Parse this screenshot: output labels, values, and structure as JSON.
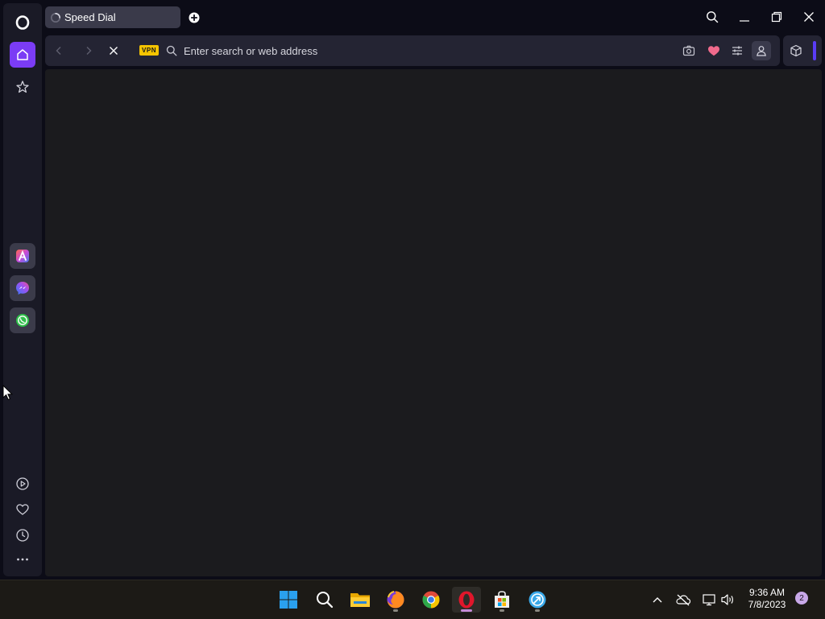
{
  "browser": {
    "tab": {
      "title": "Speed Dial",
      "loading": true
    },
    "address_bar": {
      "placeholder": "Enter search or web address",
      "value": "",
      "vpn_label": "VPN"
    }
  },
  "sidebar": {
    "top_items": [
      {
        "name": "home",
        "icon": "home-icon",
        "active": true
      },
      {
        "name": "bookmarks",
        "icon": "star-icon",
        "active": false
      }
    ],
    "apps": [
      {
        "name": "aria",
        "icon": "aria-icon"
      },
      {
        "name": "messenger",
        "icon": "messenger-icon"
      },
      {
        "name": "whatsapp",
        "icon": "whatsapp-icon"
      }
    ],
    "bottom_items": [
      {
        "name": "player",
        "icon": "play-circle-icon"
      },
      {
        "name": "my-flow",
        "icon": "heart-icon"
      },
      {
        "name": "history",
        "icon": "clock-icon"
      },
      {
        "name": "more",
        "icon": "more-icon"
      }
    ]
  },
  "taskbar": {
    "apps": [
      "windows-start",
      "search",
      "file-explorer",
      "firefox",
      "chrome",
      "opera",
      "microsoft-store",
      "arc"
    ],
    "clock": {
      "time": "9:36 AM",
      "date": "7/8/2023"
    },
    "notifications": "2"
  },
  "colors": {
    "accent": "#7b3cf5",
    "vpn_badge": "#f5c400",
    "heart": "#f06a8c"
  }
}
